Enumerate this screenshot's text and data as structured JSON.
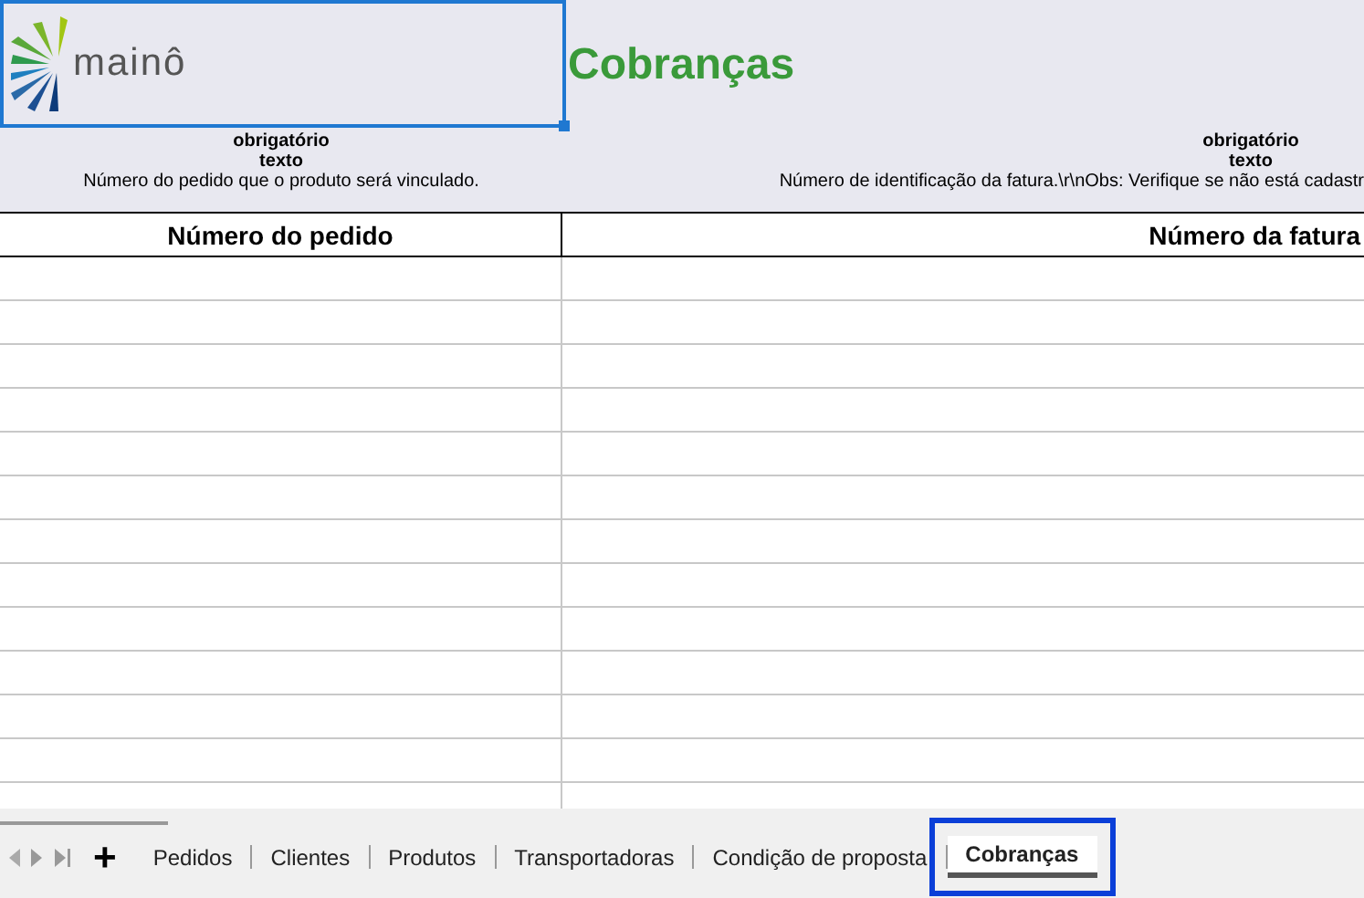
{
  "logo": {
    "text": "mainô"
  },
  "title": "Cobranças",
  "columns": [
    {
      "header": "Número do pedido",
      "required": "obrigatório",
      "type": "texto",
      "description": "Número do pedido que o produto será vinculado."
    },
    {
      "header": "Número da fatura",
      "required": "obrigatório",
      "type": "texto",
      "description": "Número de identificação da fatura.\\r\\nObs: Verifique se não está cadastr"
    }
  ],
  "sheet_tabs": [
    {
      "label": "Pedidos",
      "selected": false
    },
    {
      "label": "Clientes",
      "selected": false
    },
    {
      "label": "Produtos",
      "selected": false
    },
    {
      "label": "Transportadoras",
      "selected": false
    },
    {
      "label": "Condição de proposta",
      "selected": false
    },
    {
      "label": "Cobranças",
      "selected": true
    }
  ],
  "add_sheet": "+"
}
